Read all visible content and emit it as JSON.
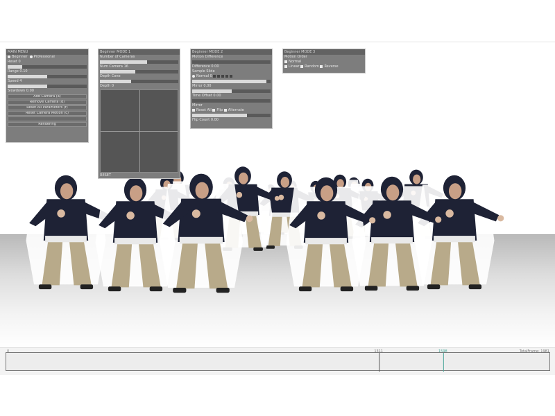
{
  "panels": [
    {
      "title": "MAIN MENU",
      "mode_options": [
        "Beginner",
        "Professional"
      ],
      "rows": [
        {
          "kind": "label",
          "text": "Reset 0"
        },
        {
          "kind": "slider",
          "value": 0.18
        },
        {
          "kind": "label",
          "text": "Range 0.10"
        },
        {
          "kind": "slider",
          "value": 0.5
        },
        {
          "kind": "label",
          "text": "Speed 4"
        },
        {
          "kind": "slider",
          "value": 0.5
        },
        {
          "kind": "label",
          "text": "Slowdown 0.00"
        }
      ],
      "buttons": [
        "Add Camera (a)",
        "Remove Camera (d)",
        "Reset All Parameters (r)",
        "Reset Camera Motion (c)",
        "",
        "Rendering"
      ]
    },
    {
      "title": "Beginner MODE 1",
      "rows": [
        {
          "kind": "label",
          "text": "Number of Cameras"
        },
        {
          "kind": "slider",
          "value": 0.6
        },
        {
          "kind": "label",
          "text": "Num Camera 16"
        },
        {
          "kind": "slider",
          "value": 0.45
        },
        {
          "kind": "label",
          "text": "Depth Cone"
        },
        {
          "kind": "slider",
          "value": 0.4
        },
        {
          "kind": "label",
          "text": "Depth 0"
        }
      ],
      "pad_label": "RESET"
    },
    {
      "title": "Beginner MODE 2",
      "rows": [
        {
          "kind": "label",
          "text": "Motion Difference"
        },
        {
          "kind": "slider",
          "value": 0.0
        },
        {
          "kind": "label",
          "text": "Difference 0.00"
        },
        {
          "kind": "label",
          "text": "Sample Slide"
        },
        {
          "kind": "checks",
          "label": "Normal 0",
          "count": 5
        },
        {
          "kind": "slider",
          "value": 0.95
        },
        {
          "kind": "label",
          "text": "Mirror 0.00"
        },
        {
          "kind": "slider",
          "value": 0.5
        },
        {
          "kind": "label",
          "text": "Time Offset 0.00"
        },
        {
          "kind": "slider",
          "value": 0.0
        },
        {
          "kind": "label",
          "text": "Mirror"
        },
        {
          "kind": "checks3",
          "labels": [
            "Reset All",
            "Flip",
            "Alternate"
          ]
        },
        {
          "kind": "slider",
          "value": 0.7
        },
        {
          "kind": "label",
          "text": "Flip Count 0.00"
        }
      ]
    },
    {
      "title": "Beginner MODE 3",
      "rows": [
        {
          "kind": "label",
          "text": "Motion Order"
        },
        {
          "kind": "checkrow",
          "labels": [
            "Normal"
          ]
        },
        {
          "kind": "checkrow",
          "labels": [
            "Linear",
            "Random",
            "Reverse"
          ]
        }
      ]
    }
  ],
  "timeline": {
    "start_label": "0",
    "marker_label_1": "1311",
    "marker_label_2": "1598",
    "total_label": "TotalFrame: 1981",
    "marker1_frac": 0.685,
    "marker2_frac": 0.803,
    "accent": "#4aa79a"
  },
  "colors": {
    "panel_bg": "#7d7d7d",
    "hoodie": "#1e2235",
    "pants": "#b8aa8a"
  }
}
